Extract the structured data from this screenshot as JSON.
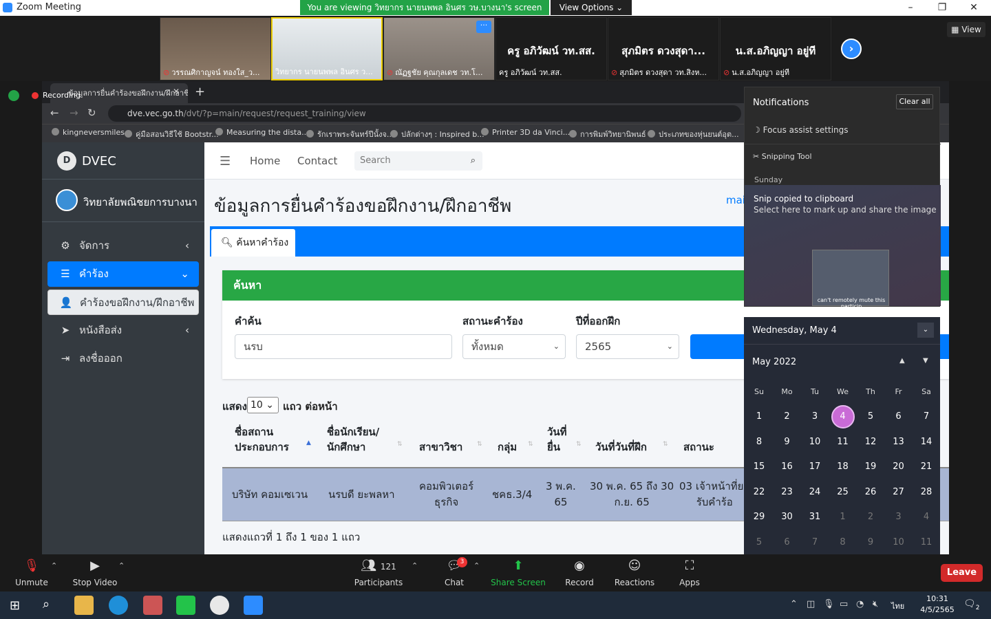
{
  "zoom": {
    "title": "Zoom Meeting",
    "viewing_banner": "You are viewing วิทยากร นายนพพล อินศร วษ.บางนา's screen",
    "view_options": "View Options",
    "view_button": "View",
    "participants_strip": [
      {
        "name": "วรรณศิกาญจน์ ทองใส_ว...",
        "muted": true
      },
      {
        "name": "วิทยากร นายนพพล อินศร ว...",
        "muted": false
      },
      {
        "name": "ณัฏฐชัย คุณกุลเดช วท.โ...",
        "muted": true
      },
      {
        "name": "ครู อภิวัฒน์ วท.สส.",
        "big": "ครู อภิวัฒน์ วท.สส.",
        "muted": false
      },
      {
        "name": "สุภมิตร ดวงสุดา วท.สิงห...",
        "big": "สุภมิตร ดวงสุดา...",
        "muted": true
      },
      {
        "name": "น.ส.อภิญญา อยู่ที",
        "big": "น.ส.อภิญญา อยู่ที",
        "muted": true
      }
    ],
    "toolbar": {
      "unmute": "Unmute",
      "stop_video": "Stop Video",
      "participants": "Participants",
      "participants_count": "121",
      "chat": "Chat",
      "chat_badge": "3",
      "share_screen": "Share Screen",
      "record": "Record",
      "reactions": "Reactions",
      "apps": "Apps",
      "leave": "Leave"
    },
    "recording": "Recording"
  },
  "browser": {
    "tab_title": "ข้อมูลการยื่นคำร้องขอฝึกงาน/ฝึกอาชีพ",
    "url_host": "dve.vec.go.th",
    "url_path": "/dvt/?p=main/request/request_training/view",
    "bookmarks": [
      "kingneversmiles",
      "คู่มือสอนวิธีใช้ Bootstr...",
      "Measuring the dista...",
      "รักเราพระจันทร์ปีนั้งจ...",
      "ปลักต่างๆ : Inspired b...",
      "Printer 3D da Vinci...",
      "การพิมพ์วิทยานิพนธ์",
      "ประเภทของหุ่นยนต์อุต..."
    ]
  },
  "site": {
    "brand": "DVEC",
    "college": "วิทยาลัยพณิชยการบางนา",
    "menu": [
      {
        "label": "จัดการ",
        "icon": "gear-icon"
      },
      {
        "label": "คำร้อง",
        "icon": "list-icon"
      },
      {
        "label": "คำร้องขอฝึกงาน/ฝึกอาชีพ",
        "icon": "user-icon"
      },
      {
        "label": "หนังสือส่ง",
        "icon": "paper-plane-icon"
      },
      {
        "label": "ลงชื่อออก",
        "icon": "sign-out-icon"
      }
    ],
    "nav": {
      "home": "Home",
      "contact": "Contact",
      "search_placeholder": "Search"
    },
    "page_title": "ข้อมูลการยื่นคำร้องขอฝึกงาน/ฝึกอาชีพ",
    "main_link": "mai",
    "tab_search": "ค้นหาคำร้อง",
    "card_title": "ค้นหา",
    "filters": {
      "keyword_label": "คำค้น",
      "keyword_value": "นรบ",
      "status_label": "สถานะคำร้อง",
      "status_value": "ทั้งหมด",
      "year_label": "ปีที่ออกฝึก",
      "year_value": "2565"
    },
    "page_size": {
      "pre": "แสดง",
      "value": "10",
      "post": "แถว ต่อหน้า"
    },
    "table": {
      "headers": [
        "ชื่อสถาน ประกอบการ",
        "ชื่อนักเรียน/ นักศึกษา",
        "สาขาวิชา",
        "กลุ่ม",
        "วันที่ ยื่น",
        "วันที่วันที่ฝึก",
        "สถานะ"
      ],
      "h1a": "ชื่อสถาน",
      "h1b": "ประกอบการ",
      "h2a": "ชื่อนักเรียน/",
      "h2b": "นักศึกษา",
      "h3": "สาขาวิชา",
      "h4": "กลุ่ม",
      "h5a": "วันที่",
      "h5b": "ยื่น",
      "h6": "วันที่วันที่ฝึก",
      "h7": "สถานะ",
      "row": {
        "company": "บริษัท คอมเซเวน",
        "student": "นรบดี ยะพลหา",
        "major_a": "คอมพิวเตอร์",
        "major_b": "ธุรกิจ",
        "group": "ชคธ.3/4",
        "submit_a": "3 พ.ค.",
        "submit_b": "65",
        "period_a": "30 พ.ค. 65 ถึง 30",
        "period_b": "ก.ย. 65",
        "status_a": "03 เจ้าหน้าที่ยก",
        "status_b": "รับคำร้อ"
      }
    },
    "info": "แสดงแถวที่ 1 ถึง 1 ของ 1 แถว"
  },
  "notifications": {
    "title": "Notifications",
    "clear_all": "Clear all",
    "focus": "Focus assist settings",
    "app": "Snipping Tool",
    "group": "Sunday",
    "snip_title": "Snip copied to clipboard",
    "snip_sub": "Select here to mark up and share the image",
    "thumb_text": "can't remotely mute this particip"
  },
  "calendar": {
    "date_header": "Wednesday, May 4",
    "month": "May 2022",
    "dow": [
      "Su",
      "Mo",
      "Tu",
      "We",
      "Th",
      "Fr",
      "Sa"
    ],
    "weeks": [
      [
        "1",
        "2",
        "3",
        "4",
        "5",
        "6",
        "7"
      ],
      [
        "8",
        "9",
        "10",
        "11",
        "12",
        "13",
        "14"
      ],
      [
        "15",
        "16",
        "17",
        "18",
        "19",
        "20",
        "21"
      ],
      [
        "22",
        "23",
        "24",
        "25",
        "26",
        "27",
        "28"
      ],
      [
        "29",
        "30",
        "31",
        "1",
        "2",
        "3",
        "4"
      ],
      [
        "5",
        "6",
        "7",
        "8",
        "9",
        "10",
        "11"
      ]
    ],
    "today": "4"
  },
  "taskbar": {
    "time": "10:31",
    "date": "4/5/2565",
    "lang": "ไทย",
    "notif_count": "2"
  }
}
